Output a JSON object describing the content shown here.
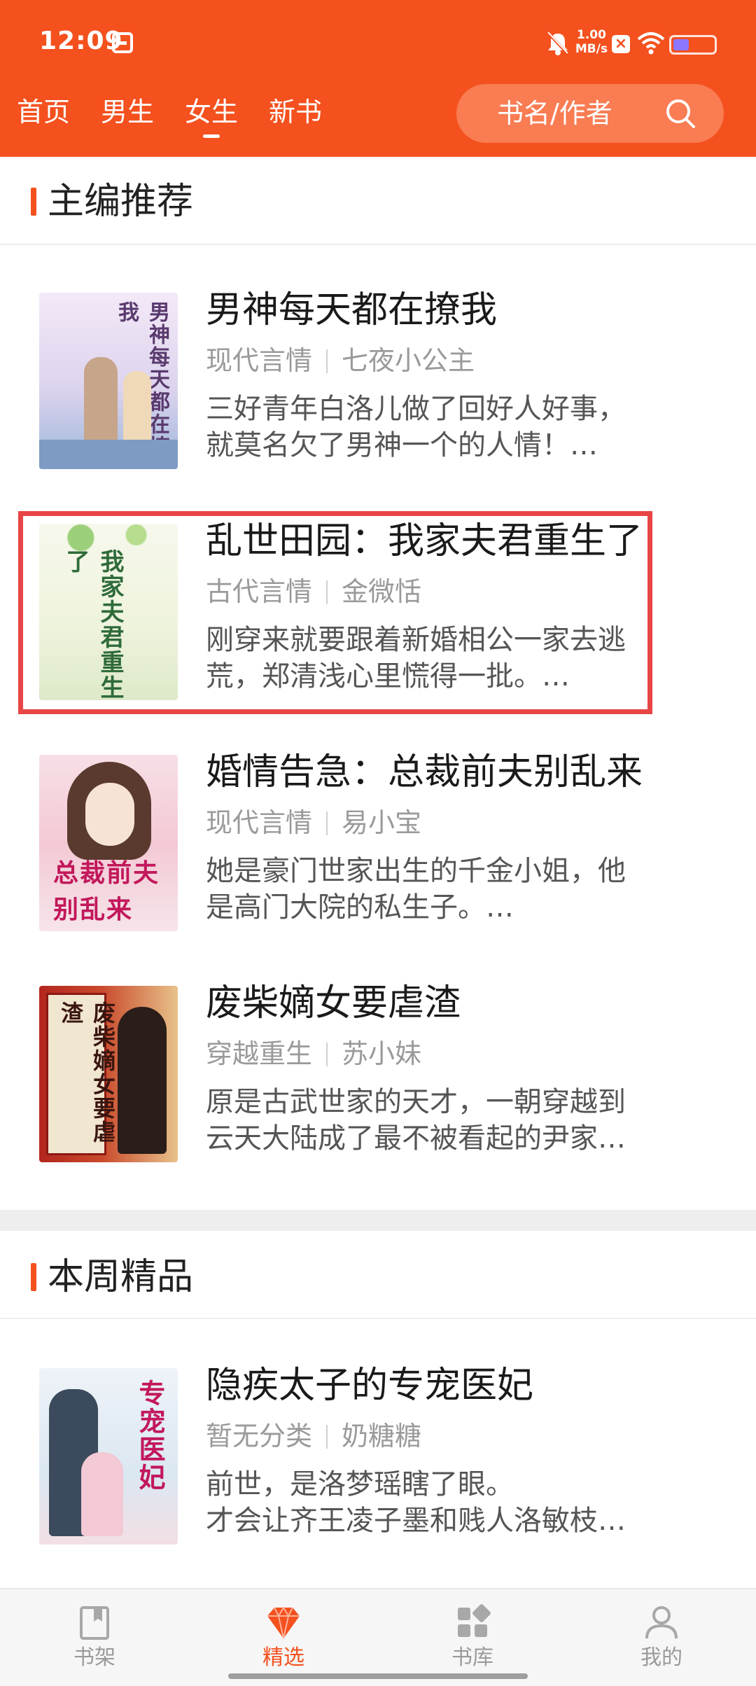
{
  "status_bar": {
    "time": "12:09",
    "net_speed_value": "1.00",
    "net_speed_unit": "MB/s"
  },
  "header": {
    "tabs": [
      {
        "label": "首页",
        "active": false
      },
      {
        "label": "男生",
        "active": false
      },
      {
        "label": "女生",
        "active": true
      },
      {
        "label": "新书",
        "active": false
      }
    ],
    "search_placeholder": "书名/作者",
    "brand_color": "#f4511e"
  },
  "sections": [
    {
      "title": "主编推荐",
      "books": [
        {
          "title": "男神每天都在撩我",
          "category": "现代言情",
          "author": "七夜小公主",
          "desc_line1": "三好青年白洛儿做了回好人好事，",
          "desc_line2": "就莫名欠了男神一个的人情！…",
          "cover_text": "男神每天都在撩我"
        },
        {
          "title": "乱世田园：我家夫君重生了",
          "category": "古代言情",
          "author": "金微恬",
          "desc_line1": "刚穿来就要跟着新婚相公一家去逃",
          "desc_line2": "荒，郑清浅心里慌得一批。…",
          "cover_text": "我家夫君重生了",
          "highlighted": true
        },
        {
          "title": "婚情告急：总裁前夫别乱来",
          "category": "现代言情",
          "author": "易小宝",
          "desc_line1": "她是豪门世家出生的千金小姐，他",
          "desc_line2": "是高门大院的私生子。…",
          "cover_text": "总裁前夫别乱来"
        },
        {
          "title": "废柴嫡女要虐渣",
          "category": "穿越重生",
          "author": "苏小妹",
          "desc_line1": "原是古武世家的天才，一朝穿越到",
          "desc_line2": "云天大陆成了最不被看起的尹家…",
          "cover_text": "废柴嫡女要虐渣"
        }
      ]
    },
    {
      "title": "本周精品",
      "books": [
        {
          "title": "隐疾太子的专宠医妃",
          "category": "暂无分类",
          "author": "奶糖糖",
          "desc_line1": "前世，是洛梦瑶瞎了眼。",
          "desc_line2": "才会让齐王凌子墨和贱人洛敏枝…",
          "cover_text": "专宠医妃"
        }
      ]
    }
  ],
  "bottom_nav": [
    {
      "label": "书架",
      "icon": "bookshelf-icon",
      "active": false
    },
    {
      "label": "精选",
      "icon": "diamond-icon",
      "active": true
    },
    {
      "label": "书库",
      "icon": "grid-icon",
      "active": false
    },
    {
      "label": "我的",
      "icon": "person-icon",
      "active": false
    }
  ]
}
